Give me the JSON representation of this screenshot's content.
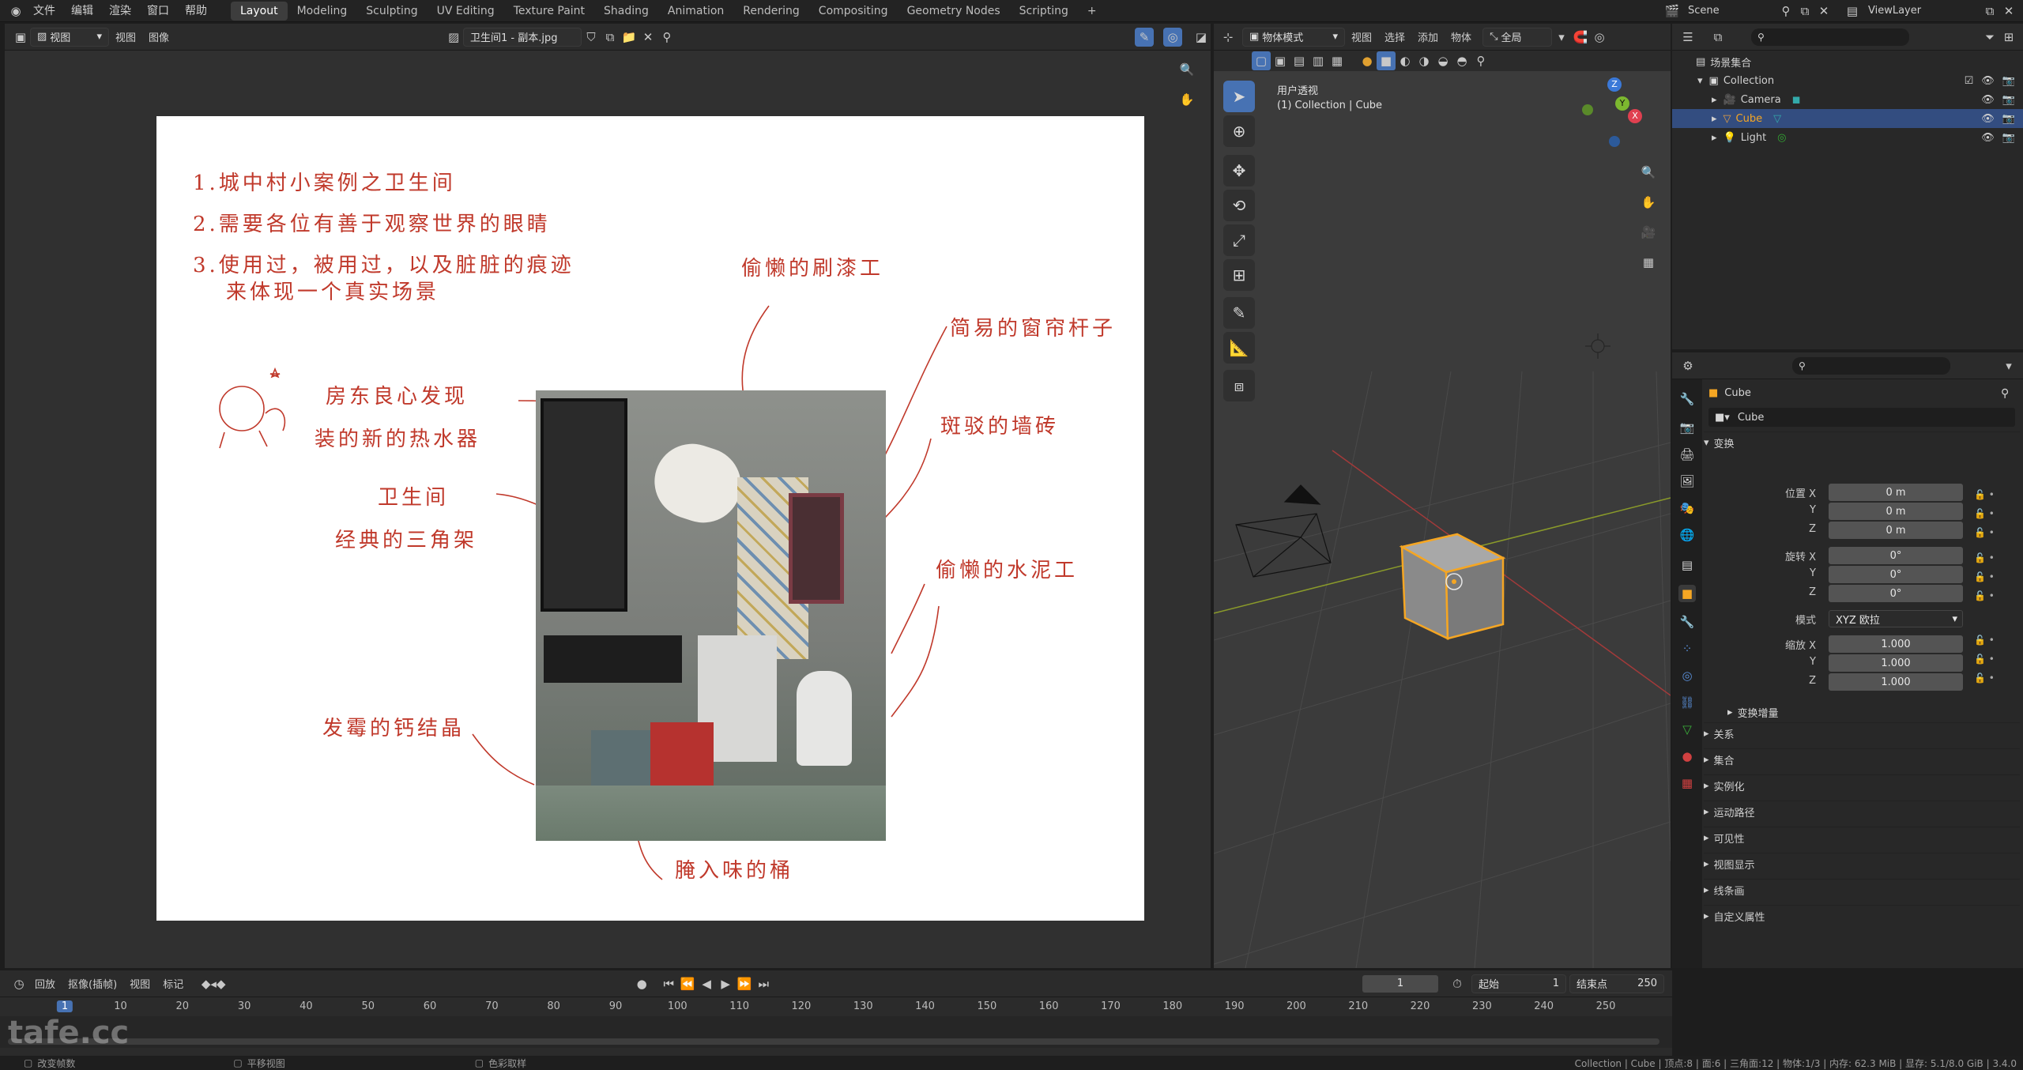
{
  "topbar": {
    "menus": [
      "文件",
      "编辑",
      "渲染",
      "窗口",
      "帮助"
    ],
    "workspaces": [
      "Layout",
      "Modeling",
      "Sculpting",
      "UV Editing",
      "Texture Paint",
      "Shading",
      "Animation",
      "Rendering",
      "Compositing",
      "Geometry Nodes",
      "Scripting"
    ],
    "active_workspace": "Layout",
    "add_tab": "+",
    "scene": "Scene",
    "view_layer": "ViewLayer"
  },
  "image_editor": {
    "mode": "视图",
    "menu_view": "视图",
    "menu_image": "图像",
    "image_name": "卫生间1 - 副本.jpg",
    "notes": {
      "line1": "1.城中村小案例之卫生间",
      "line2": "2.需要各位有善于观察世界的眼睛",
      "line3": "3.使用过，被用过，以及脏脏的痕迹",
      "line4": "来体现一个真实场景",
      "painter": "偷懒的刷漆工",
      "curtain": "简易的窗帘杆子",
      "heater1": "房东良心发现",
      "heater2": "装的新的热水器",
      "tiles": "斑驳的墙砖",
      "bathroom": "卫生间",
      "shelf": "经典的三角架",
      "cement": "偷懒的水泥工",
      "calcium": "发霉的钙结晶",
      "bucket": "腌入味的桶"
    }
  },
  "viewport": {
    "mode": "物体模式",
    "menus": [
      "视图",
      "选择",
      "添加",
      "物体"
    ],
    "orientation": "全局",
    "view_name": "用户透视",
    "collection_info": "(1) Collection | Cube",
    "axes": {
      "x": "X",
      "y": "Y",
      "z": "Z"
    }
  },
  "outliner": {
    "scene_collection": "场景集合",
    "items": [
      "Collection",
      "Camera",
      "Cube",
      "Light"
    ],
    "selected": "Cube"
  },
  "properties": {
    "object_name": "Cube",
    "data_name": "Cube",
    "transform_header": "变换",
    "location": {
      "label_x": "位置 X",
      "label_y": "Y",
      "label_z": "Z",
      "x": "0 m",
      "y": "0 m",
      "z": "0 m"
    },
    "rotation": {
      "label_x": "旋转 X",
      "label_y": "Y",
      "label_z": "Z",
      "x": "0°",
      "y": "0°",
      "z": "0°"
    },
    "mode_label": "模式",
    "mode_value": "XYZ 欧拉",
    "scale": {
      "label_x": "缩放 X",
      "label_y": "Y",
      "label_z": "Z",
      "x": "1.000",
      "y": "1.000",
      "z": "1.000"
    },
    "delta": "变换增量",
    "panels": [
      "关系",
      "集合",
      "实例化",
      "运动路径",
      "可见性",
      "视图显示",
      "线条画",
      "自定义属性"
    ]
  },
  "timeline": {
    "menus": [
      "回放",
      "抠像(插帧)",
      "视图",
      "标记"
    ],
    "current_frame": "1",
    "start_label": "起始",
    "start": "1",
    "end_label": "结束点",
    "end": "250",
    "ticks": [
      "1",
      "10",
      "20",
      "30",
      "40",
      "50",
      "60",
      "70",
      "80",
      "90",
      "100",
      "110",
      "120",
      "130",
      "140",
      "150",
      "160",
      "170",
      "180",
      "190",
      "200",
      "210",
      "220",
      "230",
      "240",
      "250"
    ]
  },
  "statusbar": {
    "left1": "改变帧数",
    "left2": "平移视图",
    "left3": "色彩取样",
    "right": "Collection | Cube | 顶点:8 | 面:6 | 三角面:12 | 物体:1/3 | 内存: 62.3 MiB | 显存: 5.1/8.0 GiB | 3.4.0"
  },
  "watermark": "tafe.cc",
  "colors": {
    "accent": "#4772b3",
    "selected_orange": "#f5a623",
    "note_red": "#c0392b"
  }
}
